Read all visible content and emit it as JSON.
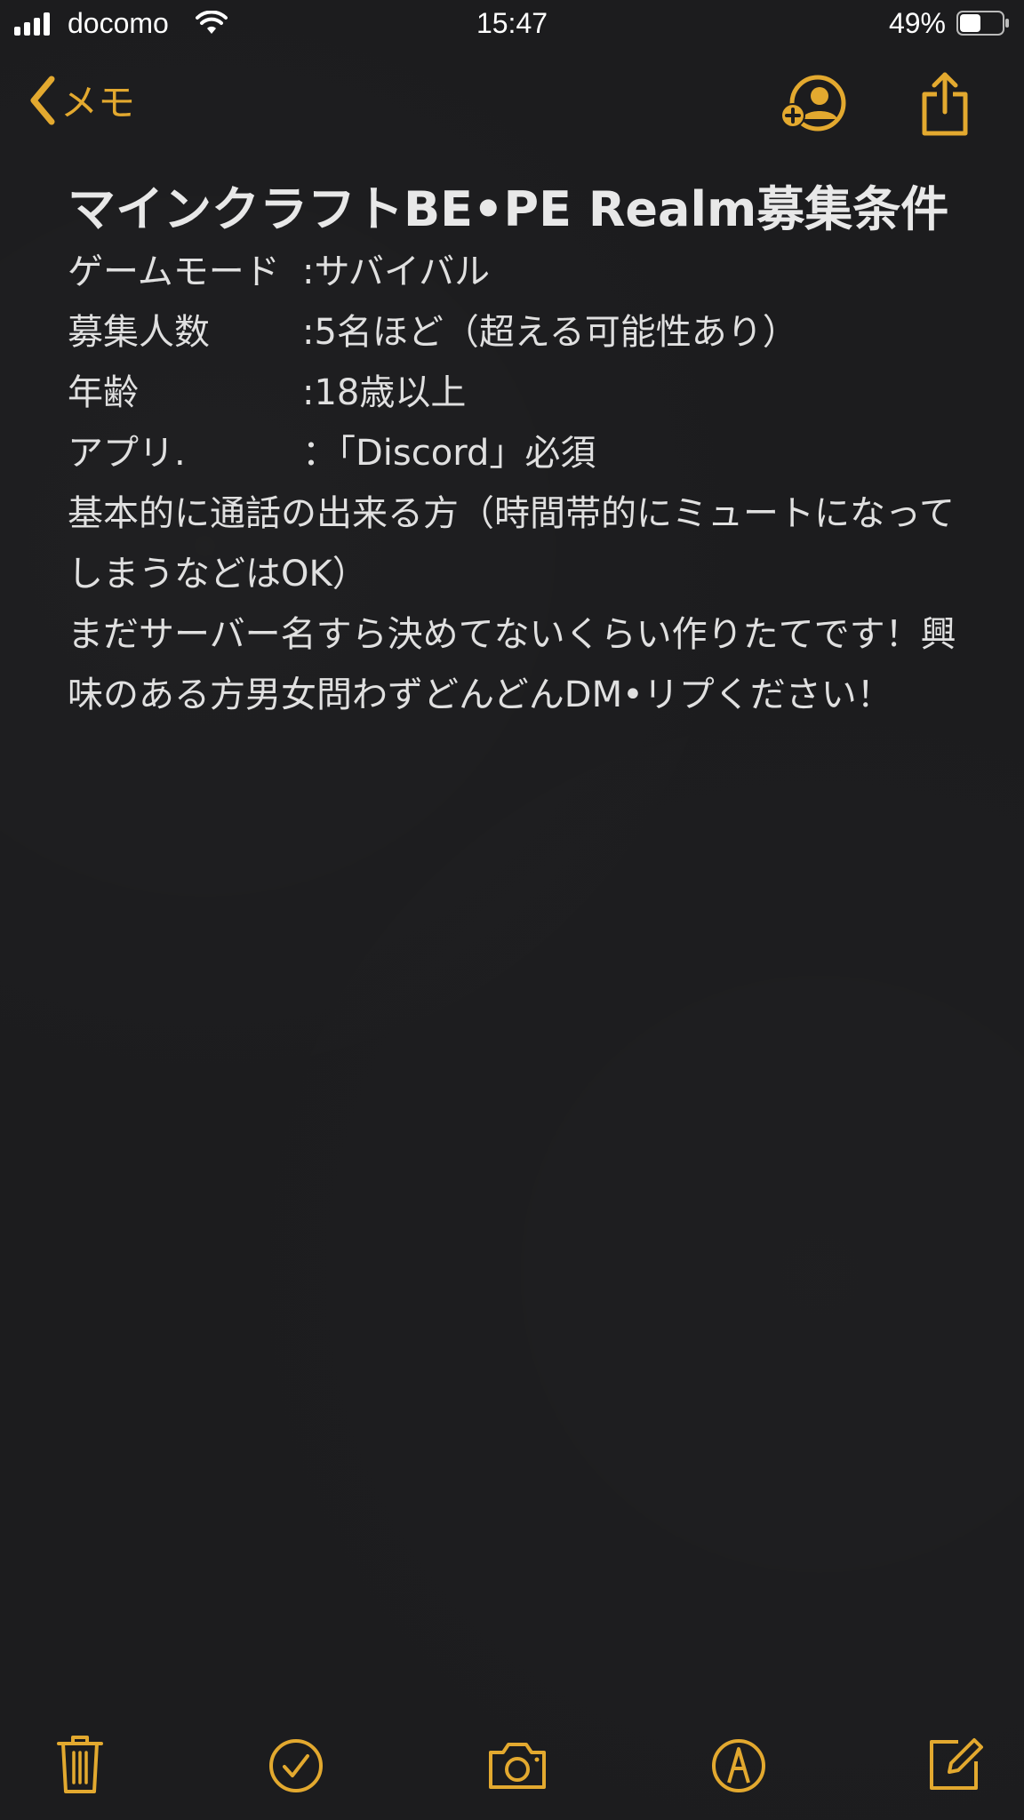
{
  "status_bar": {
    "carrier": "docomo",
    "time": "15:47",
    "battery_percent": "49%",
    "battery_level": 0.49,
    "signal_bars": 4
  },
  "nav": {
    "back_label": "メモ",
    "icons": {
      "back": "chevron-left-icon",
      "share_person": "add-person-icon",
      "share": "share-icon"
    }
  },
  "note": {
    "title": "マインクラフトBE•PE Realm募集条件",
    "fields": [
      {
        "label": "ゲームモード",
        "value": ":サバイバル"
      },
      {
        "label": "募集人数",
        "value": ":5名ほど（超える可能性あり）"
      },
      {
        "label": "年齢",
        "value": ":18歳以上"
      },
      {
        "label": "アプリ.",
        "value": "：「Discord」必須"
      }
    ],
    "paragraphs": [
      "基本的に通話の出来る方（時間帯的にミュートになってしまうなどはOK）",
      "まだサーバー名すら決めてないくらい作りたてです！興味のある方男女問わずどんどんDM•リプください！"
    ]
  },
  "toolbar": {
    "icons": [
      "trash-icon",
      "checklist-icon",
      "camera-icon",
      "markup-icon",
      "compose-icon"
    ]
  },
  "colors": {
    "accent": "#e3a92f",
    "background": "#1c1c1e",
    "text": "#e0e0e0"
  }
}
